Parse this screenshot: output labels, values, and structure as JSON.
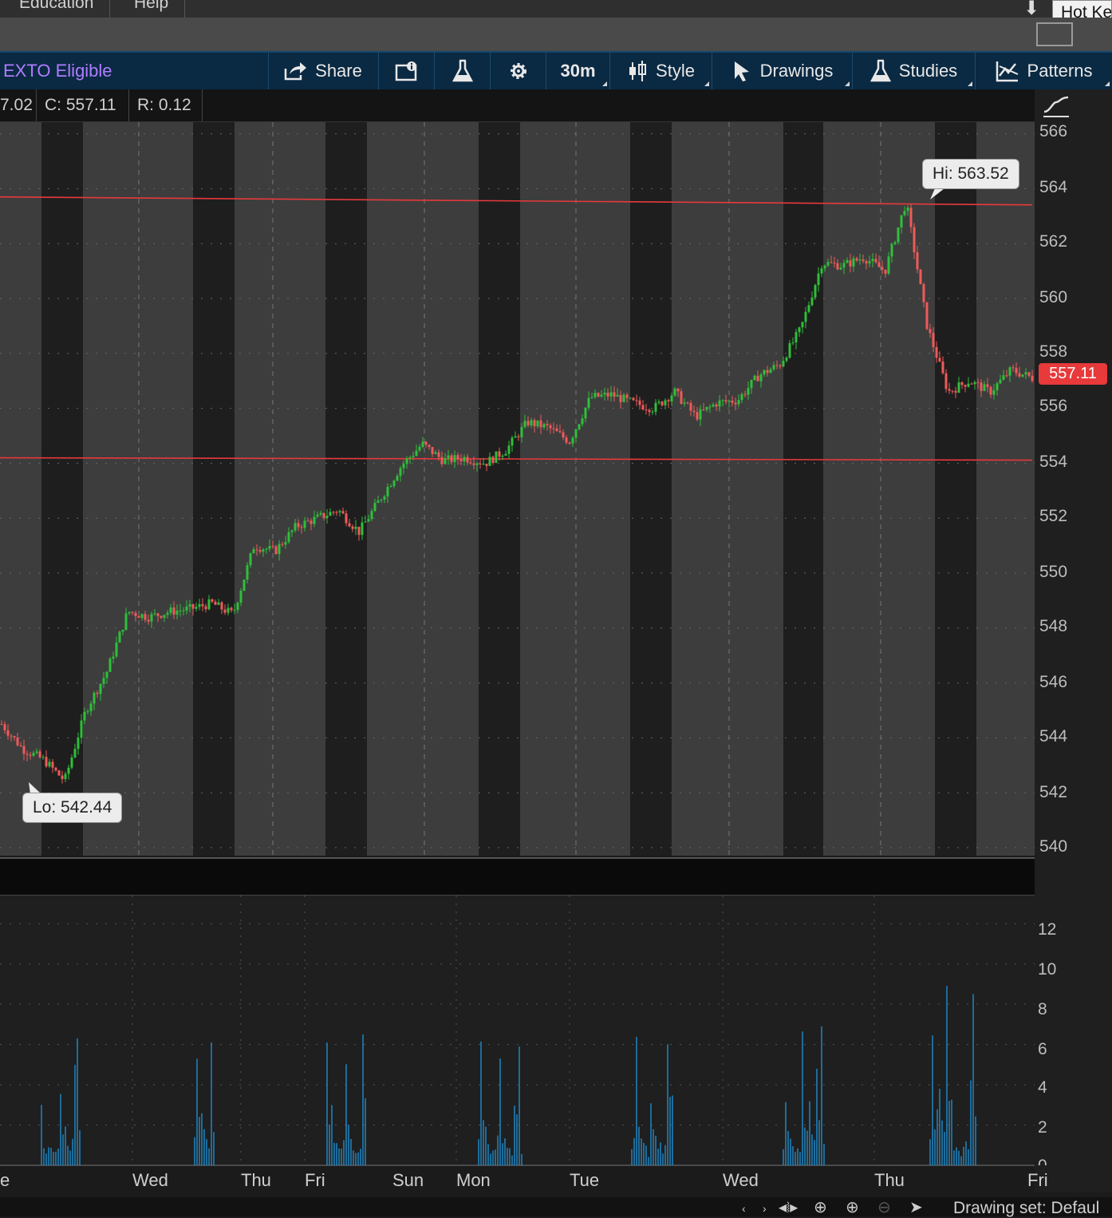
{
  "menu": {
    "items": [
      "Education",
      "Help"
    ],
    "hotkeys_label": "Hot Ke"
  },
  "toolbar": {
    "exto": "EXTO Eligible",
    "share": "Share",
    "timeframe": "30m",
    "style": "Style",
    "drawings": "Drawings",
    "studies": "Studies",
    "patterns": "Patterns"
  },
  "ohlc": {
    "low": "7.02",
    "close": "C: 557.11",
    "range": "R: 0.12"
  },
  "price_axis": [
    "566",
    "564",
    "562",
    "560",
    "558",
    "556",
    "554",
    "552",
    "550",
    "548",
    "546",
    "544",
    "542",
    "540"
  ],
  "volume_axis": [
    "12",
    "10",
    "8",
    "6",
    "4",
    "2",
    "0"
  ],
  "current_price": "557.11",
  "callouts": {
    "high": "Hi: 563.52",
    "low": "Lo: 542.44"
  },
  "x_axis": [
    "e",
    "Wed",
    "Thu",
    "Fri",
    "Sun",
    "Mon",
    "Tue",
    "Wed",
    "Thu",
    "Fri"
  ],
  "status": {
    "drawing_set": "Drawing set: Defaul"
  },
  "colors": {
    "up": "#2fbf3a",
    "down": "#f05a5a",
    "line": "#e8393b",
    "volume": "#1f86c4"
  },
  "chart_data": [
    {
      "type": "line",
      "title": "",
      "ylim": [
        540,
        566
      ],
      "x_labels": [
        "Wed",
        "Thu",
        "Fri",
        "Sun",
        "Mon",
        "Tue",
        "Wed",
        "Thu",
        "Fri"
      ],
      "series": [
        {
          "values": [
            544.5,
            543.6,
            543.2,
            542.44,
            545.0,
            546.4,
            548.6,
            548.4,
            548.6,
            548.7,
            548.9,
            548.5,
            551.0,
            550.8,
            551.7,
            552.0,
            552.3,
            551.5,
            552.7,
            553.9,
            554.7,
            554.1,
            554.2,
            554.0,
            554.5,
            555.5,
            555.3,
            554.8,
            556.4,
            556.5,
            556.2,
            556.0,
            556.6,
            555.7,
            556.2,
            556.3,
            557.2,
            557.6,
            558.9,
            561.3,
            561.2,
            561.5,
            561.0,
            563.52,
            559.0,
            556.6,
            557.0,
            556.6,
            557.4,
            557.11
          ]
        }
      ],
      "horizontal_lines": [
        563.7,
        554.2
      ]
    },
    {
      "type": "bar",
      "title": "",
      "ylim": [
        0,
        13
      ],
      "values": [
        3.0,
        1.2,
        1.0,
        1.1,
        0.8,
        1.0,
        1.2,
        1.4,
        6.2,
        2.5,
        2.8,
        1.8,
        1.2,
        1.3,
        6.1,
        2.6,
        2.8,
        1.6,
        1.2,
        1.0,
        0.9,
        1.3,
        6.4,
        2.5,
        2.4,
        1.3,
        1.0,
        1.2,
        0.8,
        1.4,
        5.9,
        2.2,
        1.7,
        1.2,
        1.0,
        0.8,
        3.2,
        2.4,
        1.5,
        1.0,
        1.1,
        0.9,
        1.3,
        6.8,
        2.0,
        3.3,
        3.6,
        2.7,
        2.0,
        8.4,
        3.4
      ]
    }
  ]
}
